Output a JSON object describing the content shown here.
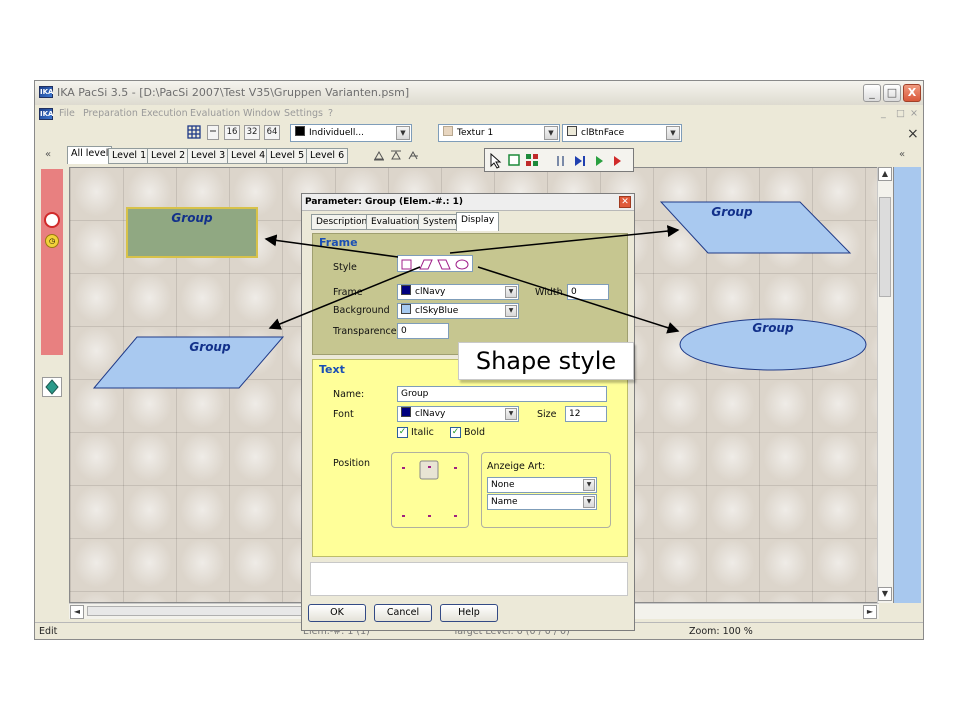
{
  "window": {
    "title": "IKA PacSi 3.5 - [D:\\PacSi 2007\\Test V35\\Gruppen Varianten.psm]",
    "app_icon": "IKA",
    "caption_buttons": [
      "_",
      "□",
      "X"
    ]
  },
  "menu": {
    "items": [
      "File",
      "Preparation",
      "Execution",
      "Evaluation",
      "Window",
      "Settings",
      "?"
    ],
    "mdi_controls": [
      "_",
      "□",
      "×"
    ]
  },
  "toolbar": {
    "grid_sizes": [
      "16",
      "32",
      "64"
    ],
    "pattern_combo": "Individuell...",
    "pattern_color": "#000000",
    "texture_combo": "Textur 1",
    "texture_color": "#e8d6c0",
    "color_combo": "clBtnFace",
    "close_label": "×"
  },
  "level_tabs": {
    "items": [
      "All level",
      "Level 1",
      "Level 2",
      "Level 3",
      "Level 4",
      "Level 5",
      "Level 6"
    ],
    "active": "All level",
    "collapse_left": "«",
    "collapse_right": "«"
  },
  "canvas": {
    "shapes": [
      {
        "kind": "rectangle",
        "label": "Group",
        "fill": "#90a882",
        "border": "#d7c24a"
      },
      {
        "kind": "parallelogram",
        "label": "Group",
        "fill": "#a9c9f0",
        "border": "#1f3a88"
      },
      {
        "kind": "parallelogram",
        "label": "Group",
        "fill": "#a9c9f0",
        "border": "#1f3a88"
      },
      {
        "kind": "ellipse",
        "label": "Group",
        "fill": "#a9c9f0",
        "border": "#1f3a88"
      }
    ]
  },
  "status": {
    "mode": "Edit",
    "elem": "Elem.-#: 1 (1)",
    "target": "Target Level: 0 (0 / 0 / 0)",
    "zoom": "Zoom: 100 %"
  },
  "dialog": {
    "title": "Parameter: Group (Elem.-#.: 1)",
    "tabs": [
      "Description",
      "Evaluation",
      "System",
      "Display"
    ],
    "active_tab": "Display",
    "frame": {
      "section": "Frame",
      "style_label": "Style",
      "frame_label": "Frame",
      "frame_value": "clNavy",
      "frame_color": "#000080",
      "width_label": "Width",
      "width_value": "0",
      "background_label": "Background",
      "background_value": "clSkyBlue",
      "background_color": "#a6caf0",
      "transparence_label": "Transparence",
      "transparence_value": "0"
    },
    "text": {
      "section": "Text",
      "name_label": "Name:",
      "name_value": "Group",
      "font_label": "Font",
      "font_value": "clNavy",
      "font_color": "#000080",
      "size_label": "Size",
      "size_value": "12",
      "italic_label": "Italic",
      "italic_checked": true,
      "bold_label": "Bold",
      "bold_checked": true,
      "position_label": "Position",
      "anzeige_label": "Anzeige Art:",
      "anzeige_value1": "None",
      "anzeige_value2": "Name"
    },
    "buttons": {
      "ok": "OK",
      "cancel": "Cancel",
      "help": "Help"
    }
  },
  "callout": {
    "text": "Shape style"
  },
  "colors": {
    "accent_red": "#e88080",
    "right_panel": "#a8c8ee",
    "frame_panel": "#c6c690",
    "text_panel": "#ffff99"
  }
}
